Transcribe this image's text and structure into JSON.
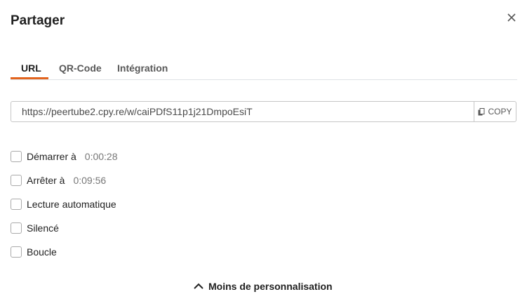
{
  "modal": {
    "title": "Partager",
    "close_icon": "close-icon"
  },
  "tabs": [
    {
      "label": "URL",
      "active": true
    },
    {
      "label": "QR-Code",
      "active": false
    },
    {
      "label": "Intégration",
      "active": false
    }
  ],
  "accent_color": "#e2641e",
  "share_url": {
    "value": "https://peertube2.cpy.re/w/caiPDfS11p1j21DmpoEsiT",
    "copy_label": "COPY",
    "copy_icon": "copy-icon"
  },
  "options": [
    {
      "label": "Démarrer à",
      "time": "0:00:28",
      "checked": false
    },
    {
      "label": "Arrêter à",
      "time": "0:09:56",
      "checked": false
    },
    {
      "label": "Lecture automatique",
      "checked": false
    },
    {
      "label": "Silencé",
      "checked": false
    },
    {
      "label": "Boucle",
      "checked": false
    }
  ],
  "customization_toggle": {
    "label": "Moins de personnalisation",
    "icon": "chevron-up-icon"
  }
}
